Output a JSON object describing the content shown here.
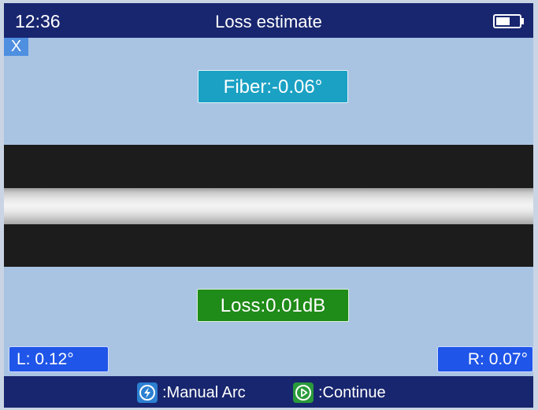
{
  "status_bar": {
    "time": "12:36",
    "title": "Loss estimate",
    "battery_icon": "battery-icon"
  },
  "close_button": {
    "label": "X"
  },
  "fiber_angle": {
    "text": "Fiber:-0.06°"
  },
  "loss": {
    "text": "Loss:0.01dB"
  },
  "left_angle": {
    "text": "L: 0.12°"
  },
  "right_angle": {
    "text": "R: 0.07°"
  },
  "footer": {
    "manual_arc": {
      "icon": "lightning-icon",
      "label": ":Manual Arc"
    },
    "continue": {
      "icon": "play-circle-icon",
      "label": ":Continue"
    }
  },
  "colors": {
    "bar_bg": "#18266f",
    "screen_bg": "#a9c3e3",
    "fiber_badge": "#1aa1c4",
    "loss_badge": "#1f8b18",
    "angle_badge": "#1f55e8",
    "close_button": "#4f8fe0"
  }
}
